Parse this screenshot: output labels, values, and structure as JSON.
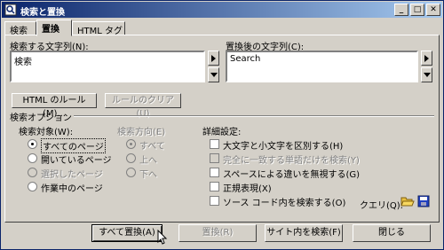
{
  "window": {
    "title": "検索と置換",
    "buttons": [
      "_",
      "□",
      "✕"
    ]
  },
  "tabs": [
    {
      "label": "検索"
    },
    {
      "label": "置換"
    },
    {
      "label": "HTML タグ"
    }
  ],
  "search": {
    "label": "検索する文字列(N):",
    "value": "検索"
  },
  "replace": {
    "label": "置換後の文字列(C):",
    "value": "Search"
  },
  "rules": {
    "html_rules_label": "HTML のルール(M)...",
    "clear_rules_label": "ルールのクリア(U)"
  },
  "options": {
    "group_label": "検索オプション",
    "target": {
      "label": "検索対象(W):",
      "items": [
        "すべてのページ",
        "開いているページ",
        "選択したページ",
        "作業中のページ"
      ]
    },
    "direction": {
      "label": "検索方向(E)",
      "items": [
        "すべて",
        "上へ",
        "下へ"
      ]
    },
    "advanced": {
      "label": "詳細設定:",
      "items": [
        "大文字と小文字を区別する(H)",
        "完全に一致する単語だけを検索(Y)",
        "スペースによる違いを無視する(G)",
        "正規表現(X)",
        "ソース コード内を検索する(O)"
      ]
    },
    "query_label": "クエリ(Q):"
  },
  "buttons": {
    "replace_all": "すべて置換(A)",
    "replace": "置換(R)",
    "find_in_site": "サイト内を検索(F)",
    "close": "閉じる"
  }
}
